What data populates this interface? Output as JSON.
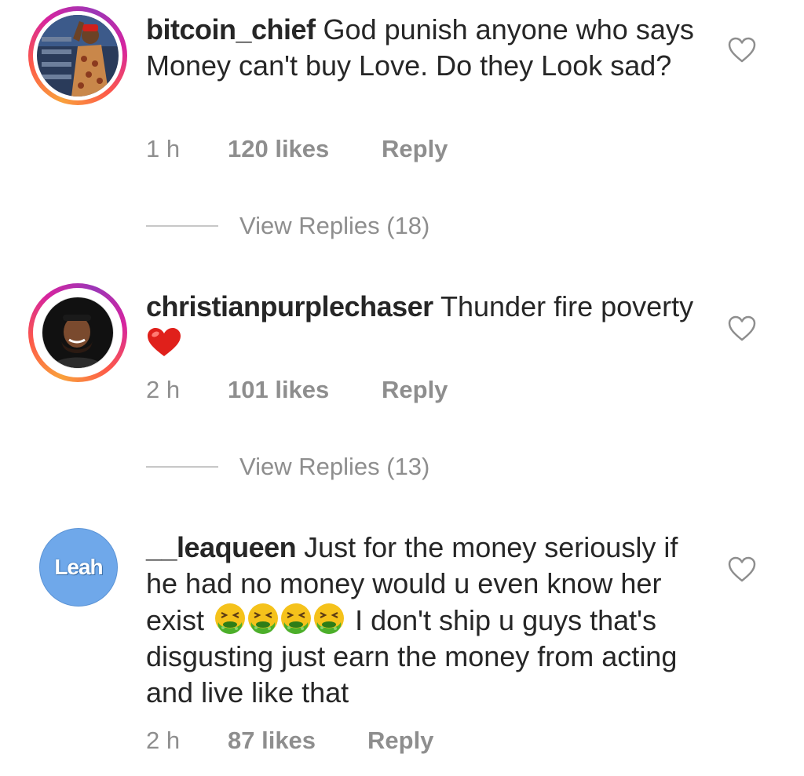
{
  "comments": [
    {
      "username": "bitcoin_chief",
      "text": "God punish anyone who says Money can't buy Love. Do they Look sad?",
      "time": "1 h",
      "likes": "120 likes",
      "reply_label": "Reply",
      "view_replies": "View Replies (18)",
      "avatar": "photo-avatar-icon"
    },
    {
      "username": "christianpurplechaser",
      "text": "Thunder fire poverty",
      "emoji": "red-heart-icon",
      "time": "2 h",
      "likes": "101 likes",
      "reply_label": "Reply",
      "view_replies": "View Replies (13)",
      "avatar": "photo-avatar-icon"
    },
    {
      "username": "__leaqueen",
      "text_before": "Just for the money seriously if he had no money would u even know her exist",
      "emoji": "nauseated-face-icon",
      "emoji_count": 4,
      "text_after": "I don't ship u guys that's disgusting just earn the money from acting and live like that",
      "avatar_label": "Leah",
      "time": "2 h",
      "likes": "87 likes",
      "reply_label": "Reply"
    }
  ],
  "colors": {
    "text": "#262626",
    "secondary": "#8e8e8e",
    "heart": "#e0201b",
    "avatar_blue": "#6fa8ea"
  },
  "icons": {
    "like": "heart-outline-icon"
  }
}
